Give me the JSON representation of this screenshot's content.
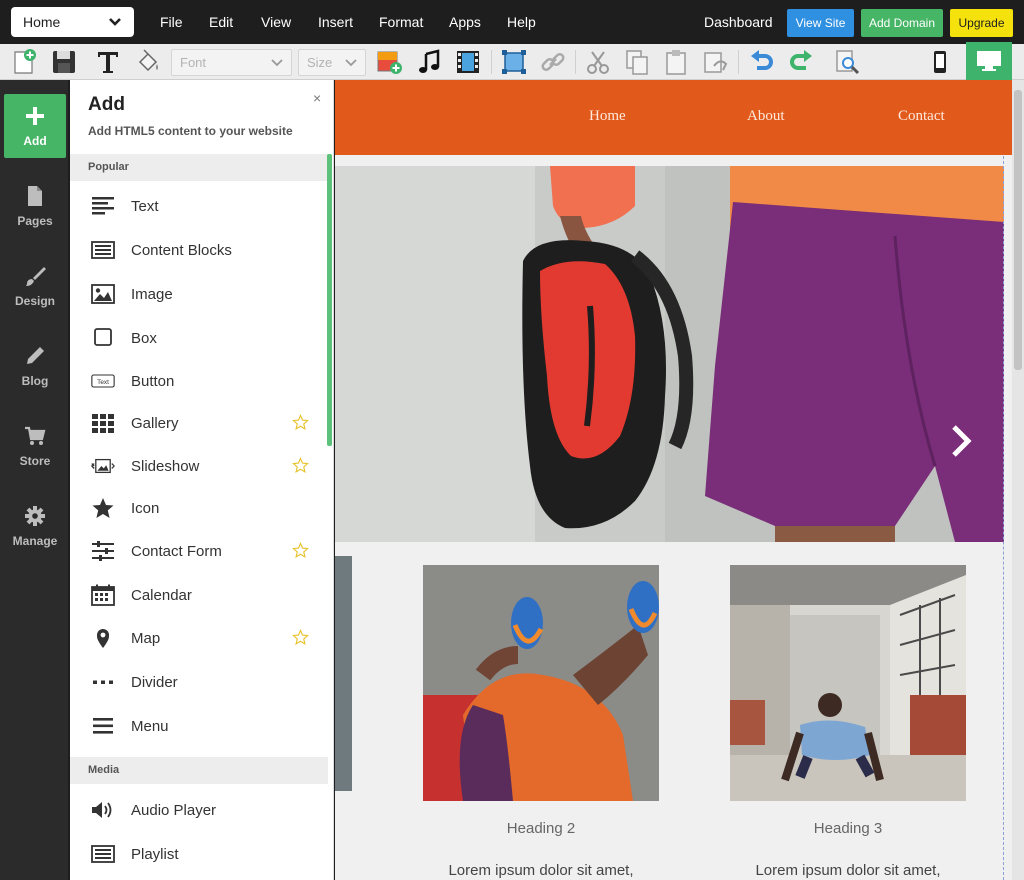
{
  "menubar": {
    "page_select": "Home",
    "menu": [
      "File",
      "Edit",
      "View",
      "Insert",
      "Format",
      "Apps",
      "Help"
    ],
    "dashboard": "Dashboard",
    "view_site": "View Site",
    "add_domain": "Add Domain",
    "upgrade": "Upgrade"
  },
  "toolbar": {
    "font_placeholder": "Font",
    "size_placeholder": "Size"
  },
  "rail": [
    "Add",
    "Pages",
    "Design",
    "Blog",
    "Store",
    "Manage"
  ],
  "panel": {
    "title": "Add",
    "subtitle": "Add HTML5 content to your website",
    "close": "×",
    "popular_label": "Popular",
    "popular_items": [
      {
        "label": "Text",
        "icon": "text-icon",
        "star": false
      },
      {
        "label": "Content Blocks",
        "icon": "content-blocks-icon",
        "star": false
      },
      {
        "label": "Image",
        "icon": "image-icon",
        "star": false
      },
      {
        "label": "Box",
        "icon": "box-icon",
        "star": false
      },
      {
        "label": "Button",
        "icon": "button-icon",
        "star": false
      },
      {
        "label": "Gallery",
        "icon": "gallery-icon",
        "star": true
      },
      {
        "label": "Slideshow",
        "icon": "slideshow-icon",
        "star": true
      },
      {
        "label": "Icon",
        "icon": "star-icon",
        "star": false
      },
      {
        "label": "Contact Form",
        "icon": "sliders-icon",
        "star": true
      },
      {
        "label": "Calendar",
        "icon": "calendar-icon",
        "star": false
      },
      {
        "label": "Map",
        "icon": "map-pin-icon",
        "star": true
      },
      {
        "label": "Divider",
        "icon": "divider-icon",
        "star": false
      },
      {
        "label": "Menu",
        "icon": "menu-icon",
        "star": false
      }
    ],
    "button_icon_text": "Text",
    "media_label": "Media",
    "media_items": [
      {
        "label": "Audio Player",
        "icon": "speaker-icon"
      },
      {
        "label": "Playlist",
        "icon": "playlist-icon"
      }
    ]
  },
  "site": {
    "nav": [
      "Home",
      "About",
      "Contact"
    ],
    "headings": [
      "Heading 2",
      "Heading 3"
    ],
    "paragraph": "Lorem ipsum dolor sit amet,"
  },
  "colors": {
    "accent_green": "#46b566",
    "view_site_blue": "#2f8fe0",
    "upgrade_yellow": "#f5e20c",
    "site_nav_orange": "#e1591b"
  }
}
